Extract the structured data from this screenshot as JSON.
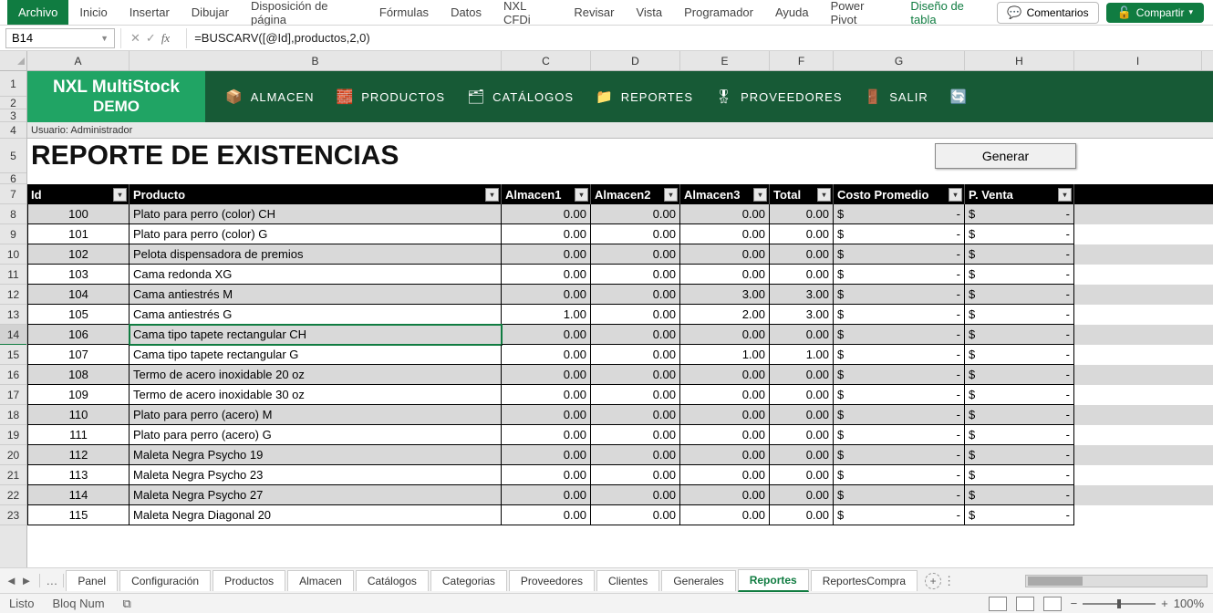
{
  "ribbon": {
    "tabs": [
      "Archivo",
      "Inicio",
      "Insertar",
      "Dibujar",
      "Disposición de página",
      "Fórmulas",
      "Datos",
      "NXL CFDi",
      "Revisar",
      "Vista",
      "Programador",
      "Ayuda",
      "Power Pivot",
      "Diseño de tabla"
    ],
    "comments": "Comentarios",
    "share": "Compartir"
  },
  "fx": {
    "namebox": "B14",
    "formula": "=BUSCARV([@Id],productos,2,0)"
  },
  "cols": [
    "A",
    "B",
    "C",
    "D",
    "E",
    "F",
    "G",
    "H",
    "I"
  ],
  "rows": [
    "1",
    "2",
    "3",
    "4",
    "5",
    "6",
    "7",
    "8",
    "9",
    "10",
    "11",
    "12",
    "13",
    "14",
    "15",
    "16",
    "17",
    "18",
    "19",
    "20",
    "21",
    "22",
    "23"
  ],
  "app": {
    "name1": "NXL MultiStock",
    "name2": "DEMO",
    "nav": [
      {
        "ico": "📦",
        "t": "ALMACEN"
      },
      {
        "ico": "🧱",
        "t": "PRODUCTOS"
      },
      {
        "ico": "🗂",
        "t": "CATÁLOGOS"
      },
      {
        "ico": "📁",
        "t": "REPORTES"
      },
      {
        "ico": "🎖",
        "t": "PROVEEDORES"
      },
      {
        "ico": "🚪",
        "t": "SALIR"
      },
      {
        "ico": "🔄",
        "t": ""
      }
    ]
  },
  "user": "Usuario: Administrador",
  "title": "REPORTE DE EXISTENCIAS",
  "btn_gen": "Generar",
  "headers": [
    "Id",
    "Producto",
    "Almacen1",
    "Almacen2",
    "Almacen3",
    "Total",
    "Costo Promedio",
    "P. Venta"
  ],
  "data": [
    {
      "id": "100",
      "p": "Plato para perro (color) CH",
      "a1": "0.00",
      "a2": "0.00",
      "a3": "0.00",
      "t": "0.00",
      "c": "-",
      "v": "-"
    },
    {
      "id": "101",
      "p": "Plato para perro (color) G",
      "a1": "0.00",
      "a2": "0.00",
      "a3": "0.00",
      "t": "0.00",
      "c": "-",
      "v": "-"
    },
    {
      "id": "102",
      "p": "Pelota dispensadora de premios",
      "a1": "0.00",
      "a2": "0.00",
      "a3": "0.00",
      "t": "0.00",
      "c": "-",
      "v": "-"
    },
    {
      "id": "103",
      "p": "Cama redonda XG",
      "a1": "0.00",
      "a2": "0.00",
      "a3": "0.00",
      "t": "0.00",
      "c": "-",
      "v": "-"
    },
    {
      "id": "104",
      "p": "Cama antiestrés M",
      "a1": "0.00",
      "a2": "0.00",
      "a3": "3.00",
      "t": "3.00",
      "c": "-",
      "v": "-"
    },
    {
      "id": "105",
      "p": "Cama antiestrés G",
      "a1": "1.00",
      "a2": "0.00",
      "a3": "2.00",
      "t": "3.00",
      "c": "-",
      "v": "-"
    },
    {
      "id": "106",
      "p": "Cama tipo tapete rectangular CH",
      "a1": "0.00",
      "a2": "0.00",
      "a3": "0.00",
      "t": "0.00",
      "c": "-",
      "v": "-"
    },
    {
      "id": "107",
      "p": "Cama tipo tapete rectangular G",
      "a1": "0.00",
      "a2": "0.00",
      "a3": "1.00",
      "t": "1.00",
      "c": "-",
      "v": "-"
    },
    {
      "id": "108",
      "p": "Termo de acero inoxidable 20 oz",
      "a1": "0.00",
      "a2": "0.00",
      "a3": "0.00",
      "t": "0.00",
      "c": "-",
      "v": "-"
    },
    {
      "id": "109",
      "p": "Termo de acero inoxidable 30 oz",
      "a1": "0.00",
      "a2": "0.00",
      "a3": "0.00",
      "t": "0.00",
      "c": "-",
      "v": "-"
    },
    {
      "id": "110",
      "p": "Plato para perro (acero) M",
      "a1": "0.00",
      "a2": "0.00",
      "a3": "0.00",
      "t": "0.00",
      "c": "-",
      "v": "-"
    },
    {
      "id": "111",
      "p": "Plato para perro (acero) G",
      "a1": "0.00",
      "a2": "0.00",
      "a3": "0.00",
      "t": "0.00",
      "c": "-",
      "v": "-"
    },
    {
      "id": "112",
      "p": "Maleta Negra Psycho 19",
      "a1": "0.00",
      "a2": "0.00",
      "a3": "0.00",
      "t": "0.00",
      "c": "-",
      "v": "-"
    },
    {
      "id": "113",
      "p": "Maleta Negra Psycho 23",
      "a1": "0.00",
      "a2": "0.00",
      "a3": "0.00",
      "t": "0.00",
      "c": "-",
      "v": "-"
    },
    {
      "id": "114",
      "p": "Maleta Negra Psycho 27",
      "a1": "0.00",
      "a2": "0.00",
      "a3": "0.00",
      "t": "0.00",
      "c": "-",
      "v": "-"
    },
    {
      "id": "115",
      "p": "Maleta Negra Diagonal 20",
      "a1": "0.00",
      "a2": "0.00",
      "a3": "0.00",
      "t": "0.00",
      "c": "-",
      "v": "-"
    }
  ],
  "money": "$",
  "wstabs": [
    "Panel",
    "Configuración",
    "Productos",
    "Almacen",
    "Catálogos",
    "Categorias",
    "Proveedores",
    "Clientes",
    "Generales",
    "Reportes",
    "ReportesCompra"
  ],
  "ws_active": 9,
  "status": {
    "ready": "Listo",
    "numlock": "Bloq Num",
    "zoom": "100%"
  }
}
